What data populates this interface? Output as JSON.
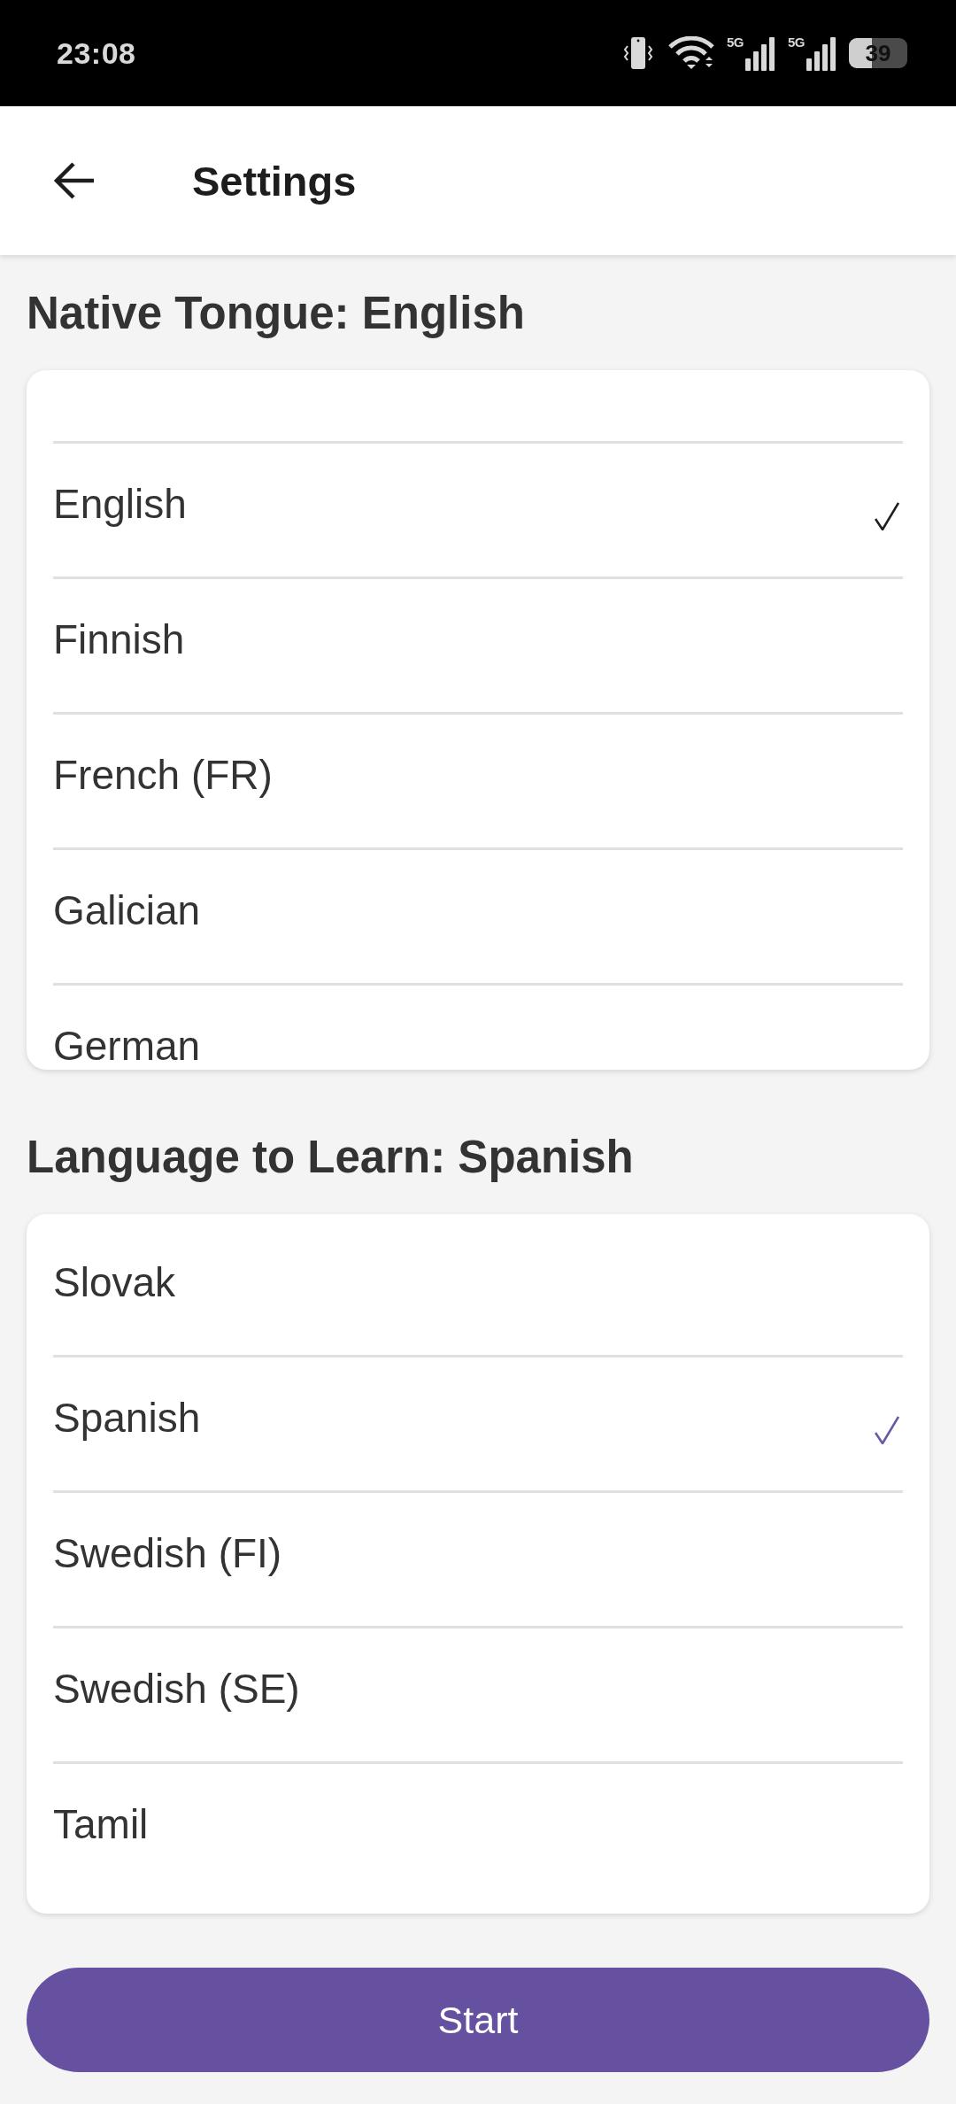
{
  "status_bar": {
    "time": "23:08",
    "network_labels": [
      "5G",
      "5G"
    ],
    "battery": "39"
  },
  "app_bar": {
    "title": "Settings"
  },
  "sections": [
    {
      "heading": "Native Tongue: English",
      "scrolled": true,
      "color": "#1f1f1f",
      "options": [
        {
          "label": "English",
          "selected": true
        },
        {
          "label": "Finnish",
          "selected": false
        },
        {
          "label": "French (FR)",
          "selected": false
        },
        {
          "label": "Galician",
          "selected": false
        },
        {
          "label": "German",
          "selected": false
        }
      ]
    },
    {
      "heading": "Language to Learn: Spanish",
      "scrolled": false,
      "color": "#6a58a4",
      "options": [
        {
          "label": "Slovak",
          "selected": false
        },
        {
          "label": "Spanish",
          "selected": true
        },
        {
          "label": "Swedish (FI)",
          "selected": false
        },
        {
          "label": "Swedish (SE)",
          "selected": false
        },
        {
          "label": "Tamil",
          "selected": false
        }
      ]
    }
  ],
  "start_button": {
    "label": "Start"
  }
}
